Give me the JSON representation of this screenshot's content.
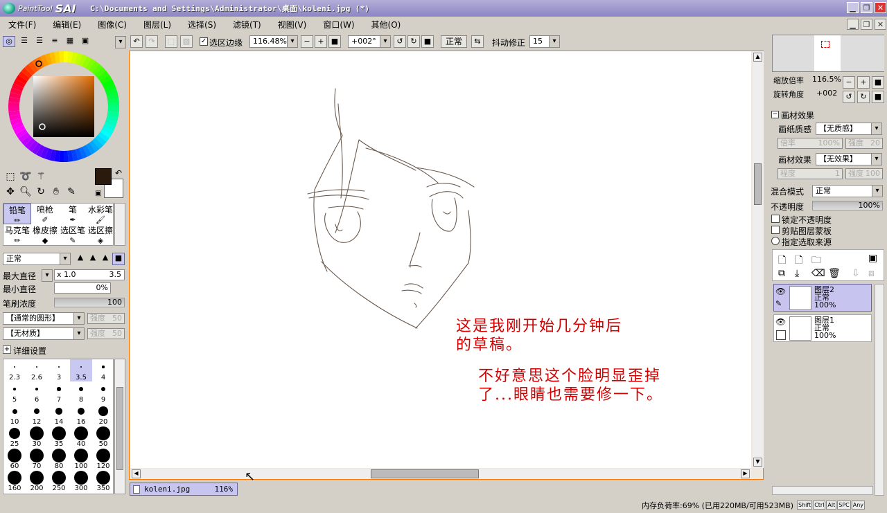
{
  "title": {
    "app_logo_small": "PaintTool",
    "app_logo": "SAI",
    "path": "C:\\Documents and Settings\\Administrator\\桌面\\koleni.jpg (*)"
  },
  "menu": [
    "文件(F)",
    "编辑(E)",
    "图像(C)",
    "图层(L)",
    "选择(S)",
    "滤镜(T)",
    "视图(V)",
    "窗口(W)",
    "其他(O)"
  ],
  "toolbar": {
    "selection_edge": "选区边缘",
    "zoom": "116.48%",
    "rotation": "+002°",
    "blend_mode": "正常",
    "stabilizer_label": "抖动修正",
    "stabilizer": "15"
  },
  "tools": {
    "row1": [
      "铅笔",
      "喷枪",
      "笔",
      "水彩笔"
    ],
    "row2": [
      "马克笔",
      "橡皮擦",
      "选区笔",
      "选区擦"
    ]
  },
  "brush": {
    "mode": "正常",
    "max_size_label": "最大直径",
    "max_size_mult": "x 1.0",
    "max_size": "3.5",
    "min_size_label": "最小直径",
    "min_size": "0%",
    "density_label": "笔刷浓度",
    "density": "100",
    "shape": "【通常的圆形】",
    "shape_strength_label": "强度",
    "shape_strength": "50",
    "texture": "【无材质】",
    "texture_strength_label": "强度",
    "texture_strength": "50",
    "details": "详细设置",
    "sizes": [
      "2.3",
      "2.6",
      "3",
      "3.5",
      "4",
      "5",
      "6",
      "7",
      "8",
      "9",
      "10",
      "12",
      "14",
      "16",
      "20",
      "25",
      "30",
      "35",
      "40",
      "50",
      "60",
      "70",
      "80",
      "100",
      "120",
      "160",
      "200",
      "250",
      "300",
      "350"
    ]
  },
  "canvas": {
    "note1_line1": "这是我刚开始几分钟后",
    "note1_line2": "的草稿。",
    "note2_line1": "不好意思这个脸明显歪掉",
    "note2_line2": "了...眼睛也需要修一下。",
    "note_color": "#d40000",
    "sketch_color": "#6b5a4e"
  },
  "doc_tab": {
    "name": "koleni.jpg",
    "zoom": "116%"
  },
  "status": {
    "memory": "内存负荷率:69% (已用220MB/可用523MB)",
    "keys": [
      "Shift",
      "Ctrl",
      "Alt",
      "SPC",
      "Any"
    ]
  },
  "navigator": {
    "zoom_label": "缩放倍率",
    "zoom": "116.5%",
    "angle_label": "旋转角度",
    "angle": "+002"
  },
  "paper": {
    "section": "画材效果",
    "texture_label": "画纸质感",
    "texture": "【无质感】",
    "tex_scale_label": "倍率",
    "tex_scale": "100%",
    "tex_strength_label": "强度",
    "tex_strength": "20",
    "effect_label": "画材效果",
    "effect": "【无效果】",
    "eff_level_label": "程度",
    "eff_level": "1",
    "eff_strength_label": "强度",
    "eff_strength": "100"
  },
  "layer_props": {
    "blend_label": "混合模式",
    "blend": "正常",
    "opacity_label": "不透明度",
    "opacity": "100%",
    "lock_opacity": "锁定不透明度",
    "clip_group": "剪贴图层蒙板",
    "sel_source": "指定选取来源"
  },
  "layers": [
    {
      "name": "图层2",
      "mode": "正常",
      "opacity": "100%"
    },
    {
      "name": "图层1",
      "mode": "正常",
      "opacity": "100%"
    }
  ],
  "colors": {
    "primary": "#2a1a0e",
    "secondary": "#ffffff",
    "title_grad": "#9a94cc"
  }
}
